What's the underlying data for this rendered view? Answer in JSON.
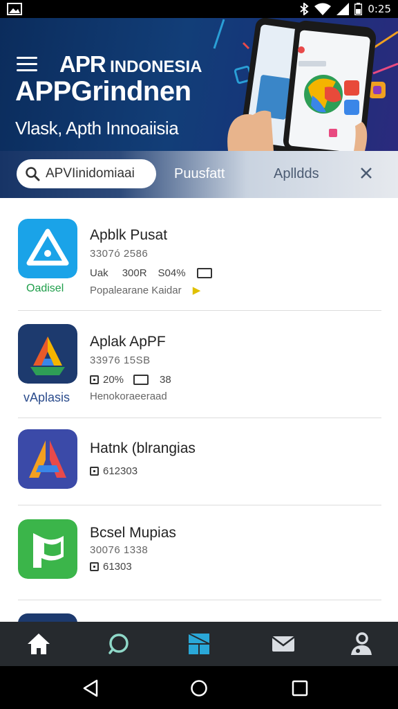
{
  "status_bar": {
    "time": "0:25",
    "icons": [
      "image-icon",
      "bluetooth-icon",
      "wifi-icon",
      "signal-icon",
      "battery-icon"
    ]
  },
  "header": {
    "brand_logo": "APR",
    "brand_name": "INDONESIA",
    "title": "APPGrindnen",
    "subtitle": "Vlask, Apth Innoaiisia",
    "background_color": "#0b2c5c"
  },
  "search": {
    "value": "APVIinidomiaai",
    "tabs": [
      {
        "label": "Puusfatt"
      },
      {
        "label": "Aplldds"
      }
    ]
  },
  "apps": [
    {
      "name": "Apblk Pusat",
      "meta": "3307ó   2586",
      "caption": "Oadisel",
      "caption_color": "#1e9e4a",
      "details": [
        "Uak",
        "300R",
        "S04%"
      ],
      "desc": "Popalearane Kaidar",
      "icon": "triangle-app-icon",
      "icon_color": "#1aa3e8"
    },
    {
      "name": "Aplak ApPF",
      "meta": "33976   15SB",
      "caption": "vAplasis",
      "caption_color": "#2a4b8c",
      "details": [
        "20%",
        "38"
      ],
      "desc": "Henokoraeeraad",
      "icon": "colorful-a-app-icon",
      "icon_color": "#1d3a6e"
    },
    {
      "name": "Hatnk (blrangias",
      "meta": "",
      "caption": "",
      "caption_color": "#333333",
      "details": [
        "612303"
      ],
      "desc": "",
      "icon": "letter-a-app-icon",
      "icon_color": "#3b4aa8"
    },
    {
      "name": "Bcsel Mupias",
      "meta": "30076   1338",
      "caption": "",
      "caption_color": "#333333",
      "details": [
        "61303"
      ],
      "desc": "",
      "icon": "green-flag-app-icon",
      "icon_color": "#3bb54a"
    }
  ],
  "bottom_nav": {
    "items": [
      "home-icon",
      "search-circle-icon",
      "apps-grid-icon",
      "mail-icon",
      "profile-icon"
    ],
    "active_color": "#2aa8d8"
  },
  "system_nav": {
    "items": [
      "back-icon",
      "home-circle-icon",
      "recents-icon"
    ]
  }
}
